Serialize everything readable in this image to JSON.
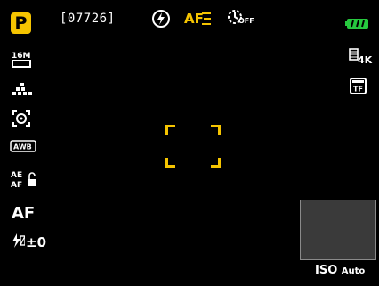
{
  "mode": {
    "label": "P"
  },
  "shots_remaining": "[07726]",
  "flash": {
    "icon": "flash-off-icon"
  },
  "af_mode": {
    "label": "AF"
  },
  "self_timer": {
    "label": "OFF"
  },
  "battery": {
    "level": 1.0,
    "color": "#27c93f"
  },
  "left_panel": {
    "image_size": "16M",
    "white_balance": "AWB",
    "ae_af_lock": "AE AF",
    "focus_mode": "AF",
    "flash_compensation": "±0"
  },
  "right_panel": {
    "video_res": "4K",
    "storage": "TF"
  },
  "iso": {
    "label": "ISO",
    "value": "Auto"
  },
  "colors": {
    "accent": "#f5c400"
  }
}
